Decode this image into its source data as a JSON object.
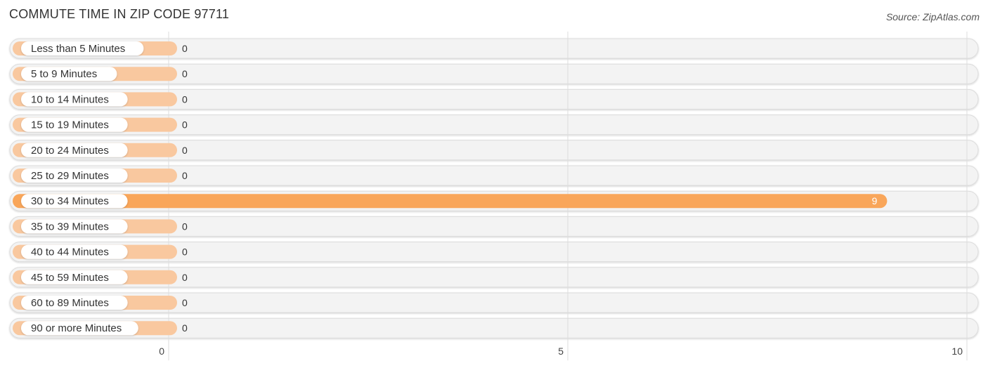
{
  "header": {
    "title": "COMMUTE TIME IN ZIP CODE 97711",
    "source": "Source: ZipAtlas.com"
  },
  "colors": {
    "bar_zero": "#f9c89f",
    "bar_highlight": "#f9a65a",
    "track": "#f3f3f3",
    "grid": "#dddddd"
  },
  "chart_data": {
    "type": "bar",
    "orientation": "horizontal",
    "title": "COMMUTE TIME IN ZIP CODE 97711",
    "categories": [
      "Less than 5 Minutes",
      "5 to 9 Minutes",
      "10 to 14 Minutes",
      "15 to 19 Minutes",
      "20 to 24 Minutes",
      "25 to 29 Minutes",
      "30 to 34 Minutes",
      "35 to 39 Minutes",
      "40 to 44 Minutes",
      "45 to 59 Minutes",
      "60 to 89 Minutes",
      "90 or more Minutes"
    ],
    "values": [
      0,
      0,
      0,
      0,
      0,
      0,
      9,
      0,
      0,
      0,
      0,
      0
    ],
    "xlabel": "",
    "ylabel": "",
    "xlim": [
      0,
      10
    ],
    "xticks": [
      0,
      5,
      10
    ],
    "grid": true,
    "legend": "none"
  }
}
